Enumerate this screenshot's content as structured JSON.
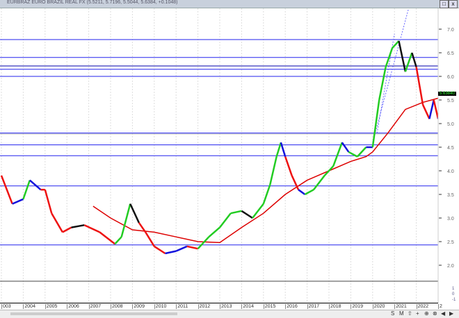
{
  "window": {
    "title": "EURBRAZ EURO BRAZIL REAL FX (5.5211, 5.7196, 5.5044, 5.6384, +0.1048)",
    "restore": "□",
    "close": "x"
  },
  "last_price": "5.63840",
  "toolbar": {
    "items": [
      "S",
      "M",
      "⇧",
      "+",
      "⊕",
      "⊗",
      "◀",
      "▶"
    ]
  },
  "chart_data": {
    "type": "line",
    "title": "EURBRAZ EURO BRAZIL REAL FX",
    "xlabel": "",
    "ylabel": "",
    "ylim": [
      1.6,
      7.6
    ],
    "x_ticks": [
      "003",
      "2004",
      "2005",
      "2006",
      "2007",
      "2008",
      "2009",
      "2010",
      "2011",
      "2012",
      "2013",
      "2014",
      "2015",
      "2016",
      "2017",
      "2018",
      "2019",
      "2020",
      "2021",
      "2022",
      "2"
    ],
    "y_ticks": [
      7.0,
      6.5,
      6.0,
      5.5,
      5.0,
      4.5,
      4.0,
      3.5,
      3.0,
      2.5,
      2.0
    ],
    "sub_y_ticks": [
      "1",
      "0",
      "-1"
    ],
    "price": [
      [
        2003,
        3.9,
        "black"
      ],
      [
        2003.5,
        3.3,
        "red"
      ],
      [
        2004,
        3.4,
        "blue"
      ],
      [
        2004.3,
        3.8,
        "green"
      ],
      [
        2004.8,
        3.6,
        "blue"
      ],
      [
        2005,
        3.6,
        "red"
      ],
      [
        2005.3,
        3.1,
        "red"
      ],
      [
        2005.8,
        2.7,
        "red"
      ],
      [
        2006.2,
        2.8,
        "red"
      ],
      [
        2006.8,
        2.85,
        "black"
      ],
      [
        2007.5,
        2.7,
        "red"
      ],
      [
        2008.2,
        2.45,
        "red"
      ],
      [
        2008.5,
        2.6,
        "green"
      ],
      [
        2008.9,
        3.3,
        "green"
      ],
      [
        2009.3,
        2.9,
        "black"
      ],
      [
        2009.6,
        2.7,
        "red"
      ],
      [
        2010,
        2.4,
        "red"
      ],
      [
        2010.5,
        2.25,
        "red"
      ],
      [
        2011,
        2.3,
        "blue"
      ],
      [
        2011.5,
        2.4,
        "blue"
      ],
      [
        2012,
        2.35,
        "red"
      ],
      [
        2012.5,
        2.6,
        "green"
      ],
      [
        2013,
        2.8,
        "green"
      ],
      [
        2013.5,
        3.1,
        "green"
      ],
      [
        2014,
        3.15,
        "green"
      ],
      [
        2014.5,
        3.0,
        "black"
      ],
      [
        2015,
        3.3,
        "green"
      ],
      [
        2015.3,
        3.7,
        "green"
      ],
      [
        2015.6,
        4.3,
        "green"
      ],
      [
        2015.8,
        4.6,
        "green"
      ],
      [
        2016,
        4.3,
        "blue"
      ],
      [
        2016.3,
        3.9,
        "red"
      ],
      [
        2016.6,
        3.6,
        "red"
      ],
      [
        2016.9,
        3.5,
        "blue"
      ],
      [
        2017.3,
        3.6,
        "green"
      ],
      [
        2017.8,
        3.9,
        "green"
      ],
      [
        2018.2,
        4.1,
        "green"
      ],
      [
        2018.6,
        4.6,
        "green"
      ],
      [
        2018.9,
        4.4,
        "blue"
      ],
      [
        2019.3,
        4.3,
        "green"
      ],
      [
        2019.7,
        4.5,
        "green"
      ],
      [
        2020,
        4.5,
        "blue"
      ],
      [
        2020.3,
        5.5,
        "green"
      ],
      [
        2020.6,
        6.2,
        "green"
      ],
      [
        2020.9,
        6.6,
        "green"
      ],
      [
        2021.2,
        6.75,
        "green"
      ],
      [
        2021.5,
        6.1,
        "black"
      ],
      [
        2021.8,
        6.5,
        "green"
      ],
      [
        2022,
        6.2,
        "black"
      ],
      [
        2022.3,
        5.4,
        "red"
      ],
      [
        2022.6,
        5.1,
        "red"
      ],
      [
        2022.8,
        5.5,
        "blue"
      ],
      [
        2023,
        5.1,
        "red"
      ],
      [
        2023.3,
        5.6,
        "blue"
      ],
      [
        2023.5,
        5.64,
        "blue"
      ]
    ],
    "moving_average": [
      [
        2007.2,
        3.25
      ],
      [
        2008,
        3.0
      ],
      [
        2009,
        2.75
      ],
      [
        2010,
        2.7
      ],
      [
        2011,
        2.6
      ],
      [
        2012,
        2.5
      ],
      [
        2013,
        2.48
      ],
      [
        2014,
        2.8
      ],
      [
        2015,
        3.1
      ],
      [
        2016,
        3.5
      ],
      [
        2017,
        3.8
      ],
      [
        2018,
        4.0
      ],
      [
        2019,
        4.2
      ],
      [
        2019.7,
        4.3
      ],
      [
        2020,
        4.4
      ],
      [
        2020.7,
        4.8
      ],
      [
        2021.5,
        5.3
      ],
      [
        2022.3,
        5.45
      ],
      [
        2023.5,
        5.6
      ]
    ],
    "horizontal_levels": [
      6.78,
      6.4,
      6.22,
      6.15,
      6.0,
      4.8,
      4.55,
      4.32,
      3.68,
      2.43
    ],
    "trendlines": [
      [
        [
          2020,
          4.6
        ],
        [
          2021.8,
          7.7
        ]
      ],
      [
        [
          2020.2,
          4.8
        ],
        [
          2021,
          6.9
        ]
      ]
    ],
    "colors": {
      "up": "#22cc22",
      "down": "#ee1111",
      "neutral": "#111111",
      "blue": "#1111dd",
      "ma": "#dd0000",
      "level": "#2222ee"
    }
  }
}
